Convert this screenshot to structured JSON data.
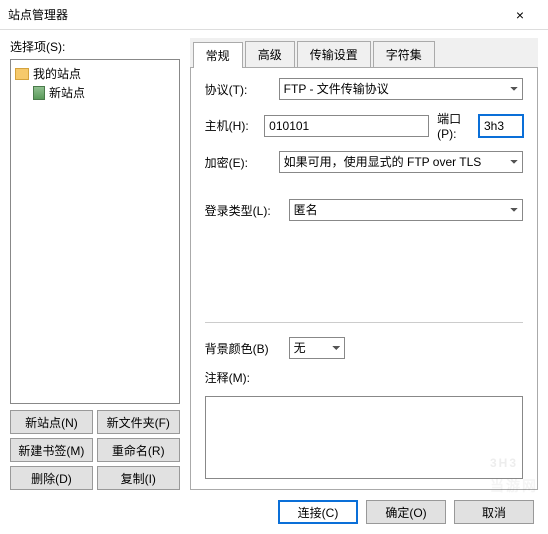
{
  "window": {
    "title": "站点管理器"
  },
  "left": {
    "label": "选择项(S):",
    "tree": {
      "root": "我的站点",
      "child": "新站点"
    },
    "buttons": {
      "new_site": "新站点(N)",
      "new_folder": "新文件夹(F)",
      "new_bookmark": "新建书签(M)",
      "rename": "重命名(R)",
      "delete": "删除(D)",
      "copy": "复制(I)"
    }
  },
  "tabs": {
    "general": "常规",
    "advanced": "高级",
    "transfer": "传输设置",
    "charset": "字符集"
  },
  "fields": {
    "protocol_label": "协议(T):",
    "protocol_value": "FTP - 文件传输协议",
    "host_label": "主机(H):",
    "host_value": "010101",
    "port_label": "端口(P):",
    "port_value": "3h3",
    "encryption_label": "加密(E):",
    "encryption_value": "如果可用，使用显式的 FTP over TLS",
    "login_type_label": "登录类型(L):",
    "login_type_value": "匿名",
    "bgcolor_label": "背景颜色(B)",
    "bgcolor_value": "无",
    "notes_label": "注释(M):",
    "notes_value": ""
  },
  "footer": {
    "connect": "连接(C)",
    "ok": "确定(O)",
    "cancel": "取消"
  },
  "watermark": {
    "big": "3H3",
    "small": "当游网"
  }
}
